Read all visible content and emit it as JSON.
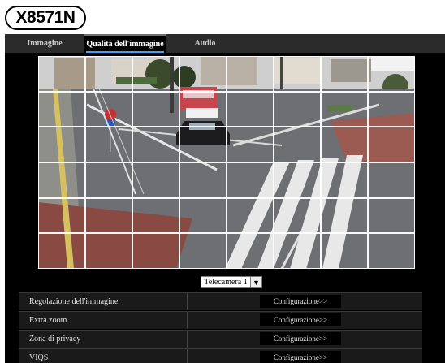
{
  "logo": {
    "text": "X8571N"
  },
  "tabs": [
    {
      "label": "Immagine",
      "active": false
    },
    {
      "label": "Qualità dell'immagine",
      "active": true
    },
    {
      "label": "Audio",
      "active": false
    }
  ],
  "camera": {
    "select_value": "Telecamera 1",
    "arrow_icon": "chevron-down-icon",
    "grid_columns": 8,
    "grid_rows": 6
  },
  "settings": [
    {
      "label": "Regolazione dell'immagine",
      "button": "Configurazione>>"
    },
    {
      "label": "Extra zoom",
      "button": "Configurazione>>"
    },
    {
      "label": "Zona di privacy",
      "button": "Configurazione>>"
    },
    {
      "label": "VIQS",
      "button": "Configurazione>>"
    }
  ],
  "colors": {
    "tab_accent": "#3aa0ff",
    "tabbar_bg": "#2b2b2b",
    "main_bg": "#000000"
  }
}
